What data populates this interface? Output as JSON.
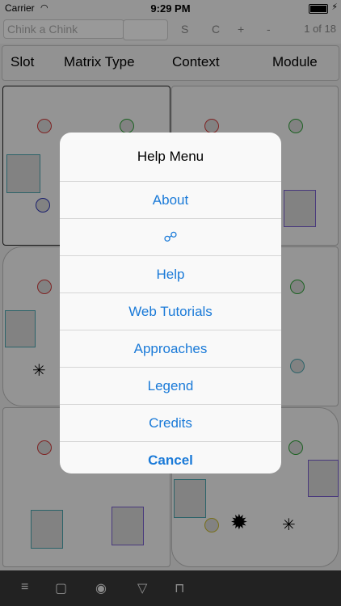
{
  "status": {
    "carrier": "Carrier",
    "time": "9:29 PM"
  },
  "toolbar": {
    "search_placeholder": "Chink a Chink",
    "s_label": "S",
    "c_label": "C",
    "plus_label": "+",
    "minus_label": "-",
    "pager": "1 of 18"
  },
  "headers": [
    "Slot",
    "Matrix Type",
    "Context",
    "Module"
  ],
  "menu": {
    "title": "Help Menu",
    "items": [
      "About",
      "☍",
      "Help",
      "Web Tutorials",
      "Approaches",
      "Legend",
      "Credits"
    ],
    "cancel": "Cancel"
  },
  "colors": {
    "accent": "#1a7ad8",
    "red": "#d43b3b",
    "green": "#2fa43a",
    "blue": "#2d36b8",
    "teal": "#4aa6b0",
    "purple": "#7a5fd0",
    "yellow": "#c8b92a"
  },
  "bottom_icons": [
    "list-icon",
    "square-icon",
    "circle-icon",
    "triangle-icon",
    "bracket-icon"
  ]
}
